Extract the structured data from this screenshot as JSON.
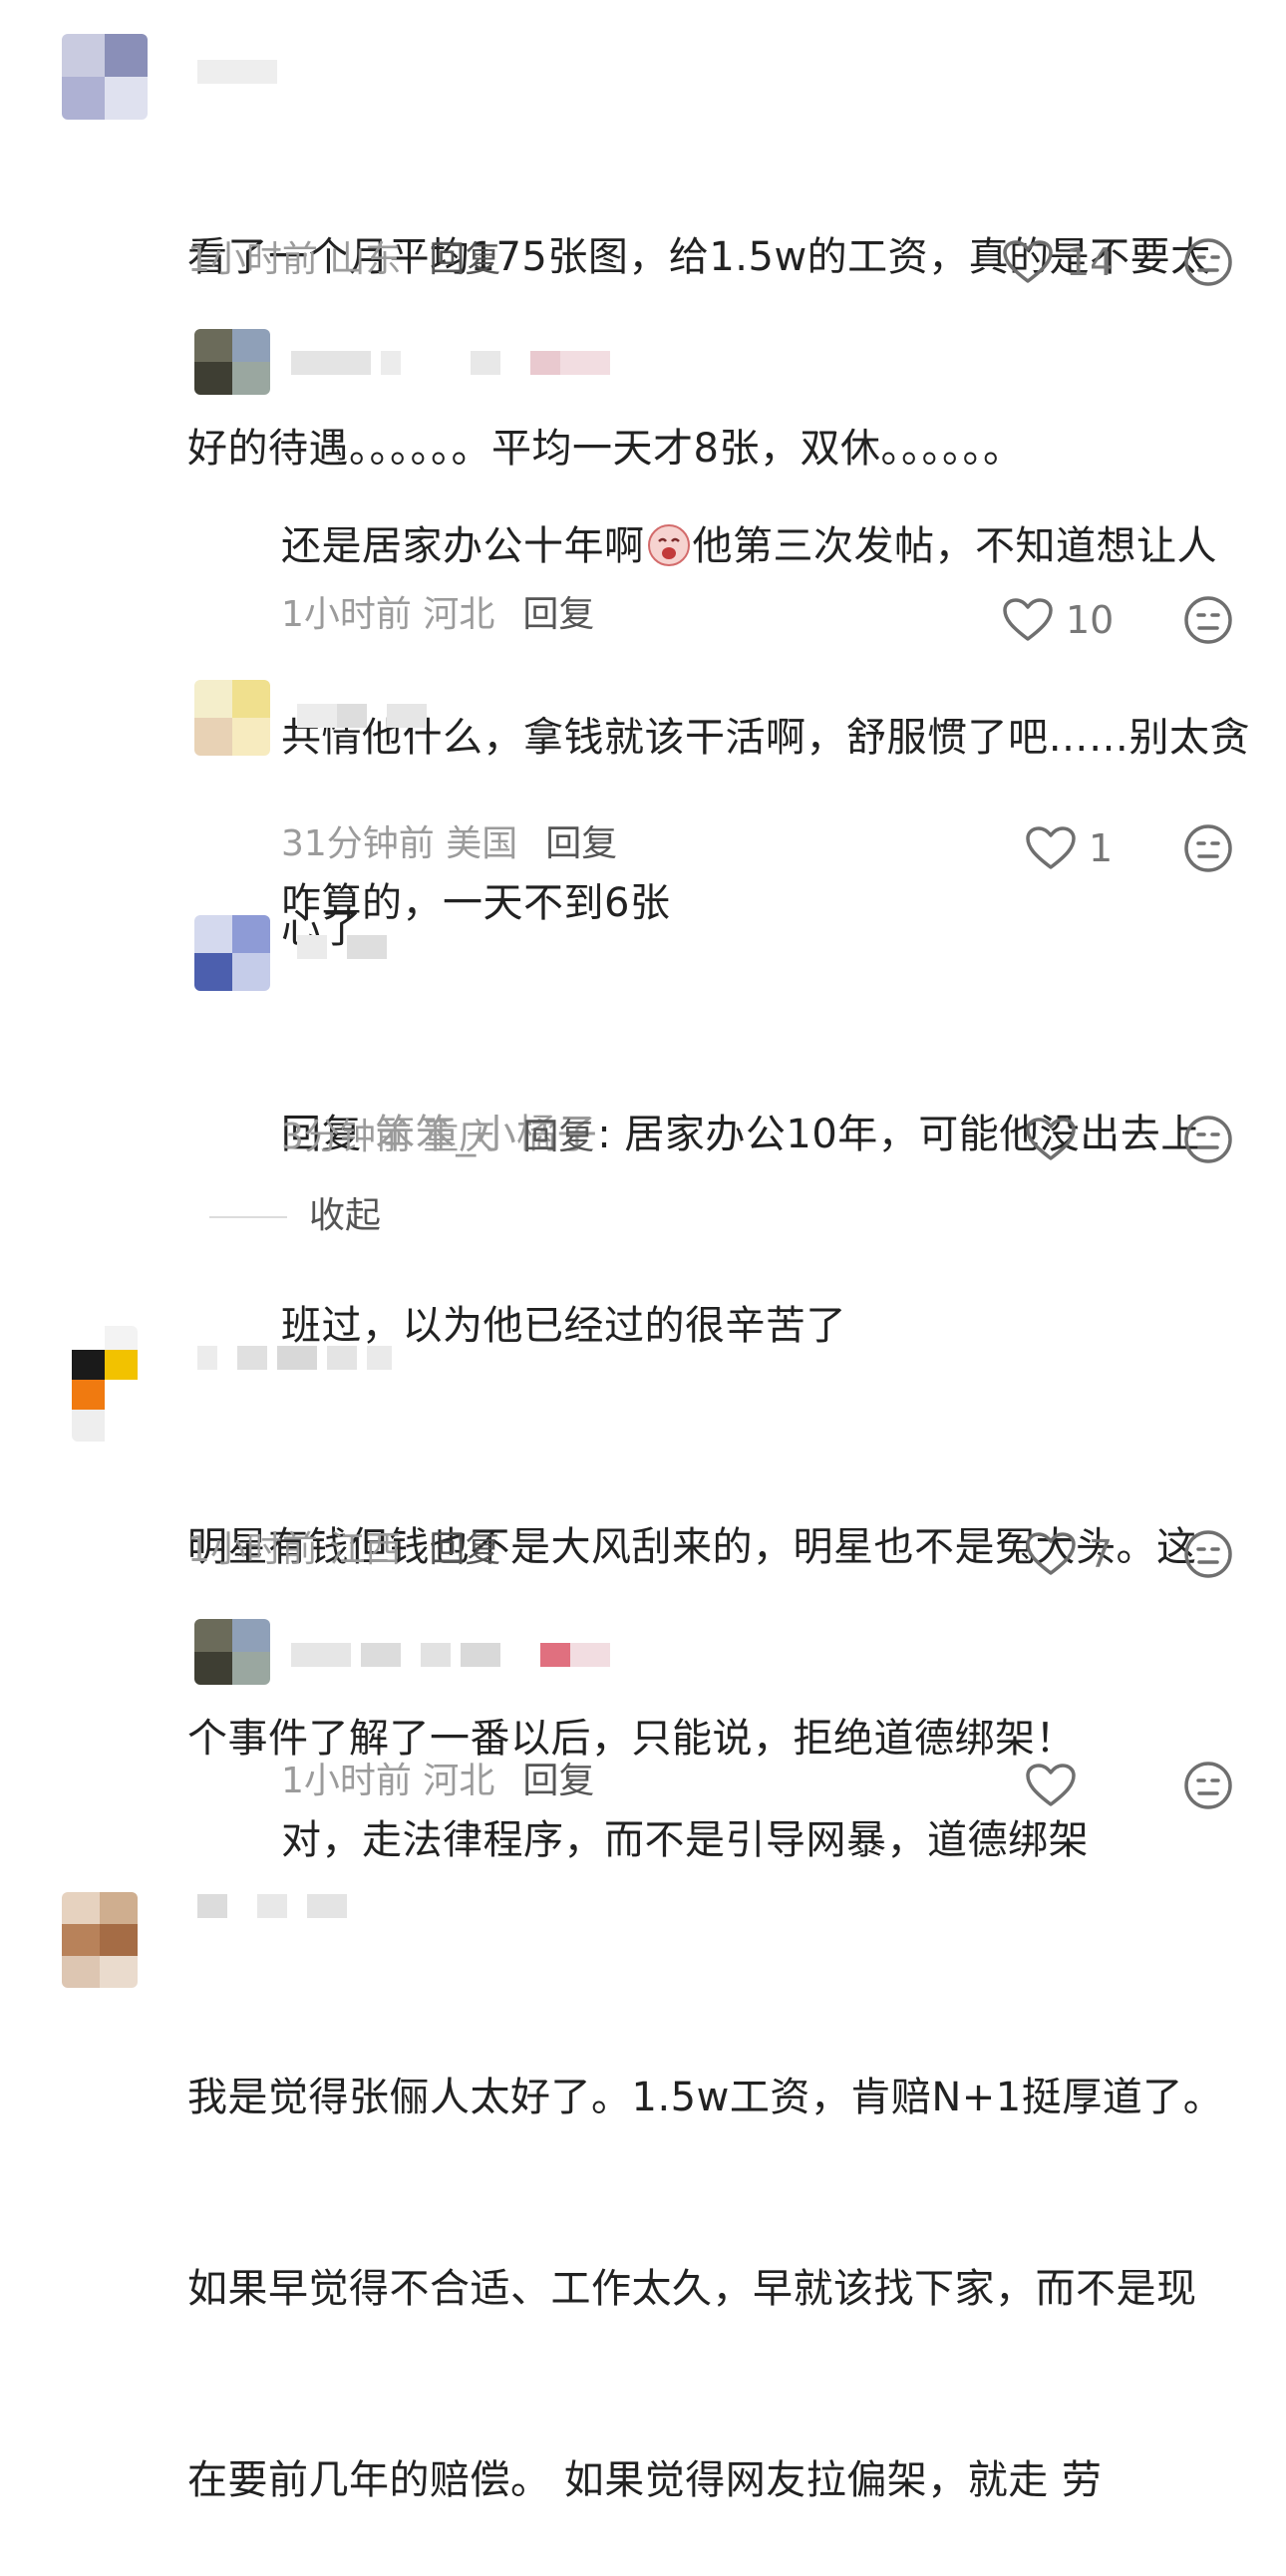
{
  "comments": [
    {
      "id": "c1",
      "text_lines": [
        "看了一个月平均175张图，给1.5w的工资，真的是不要太",
        "好的待遇。。。。。。平均一天才8张，双休。。。。。。"
      ],
      "time": "1小时前",
      "location": "山东",
      "reply_label": "回复",
      "likes": "14"
    },
    {
      "id": "c1r1",
      "text_line1_a": "还是居家办公十年啊",
      "text_line1_b": "他第三次发帖，不知道想让人",
      "text_lines_rest": [
        "共情他什么，拿钱就该干活啊，舒服惯了吧……别太贪",
        "心了"
      ],
      "time": "1小时前",
      "location": "河北",
      "reply_label": "回复",
      "likes": "10",
      "emoji": "crying-face-icon"
    },
    {
      "id": "c1r2",
      "text_lines": [
        "咋算的，一天不到6张"
      ],
      "time": "31分钟前",
      "location": "美国",
      "reply_label": "回复",
      "likes": "1"
    },
    {
      "id": "c1r3",
      "reply_prefix": "回复 ",
      "reply_to": "笨笨_小橘子",
      "text_line1_rest": ": 居家办公10年，可能他没出去上",
      "text_lines_rest": [
        "班过，以为他已经过的很辛苦了"
      ],
      "time": "3分钟前",
      "location": "重庆",
      "reply_label": "回复",
      "likes": ""
    },
    {
      "id": "c2",
      "text_lines": [
        "明星有钱但钱也不是大风刮来的，明星也不是冤大头。这",
        "个事件了解了一番以后，只能说，拒绝道德绑架！"
      ],
      "time": "1小时前",
      "location": "江西",
      "reply_label": "回复",
      "likes": "7"
    },
    {
      "id": "c2r1",
      "text_lines": [
        "对，走法律程序，而不是引导网暴，道德绑架"
      ],
      "time": "1小时前",
      "location": "河北",
      "reply_label": "回复",
      "likes": ""
    },
    {
      "id": "c3",
      "text_lines": [
        "我是觉得张俪人太好了。1.5w工资，肯赔N+1挺厚道了。",
        "如果早觉得不合适、工作太久，早就该找下家，而不是现",
        "在要前几年的赔偿。 如果觉得网友拉偏架，就走 劳"
      ]
    }
  ],
  "collapse_label": "收起",
  "colors": {
    "text": "#222222",
    "meta": "#9b9b9b",
    "icon": "#6f6f6f"
  }
}
